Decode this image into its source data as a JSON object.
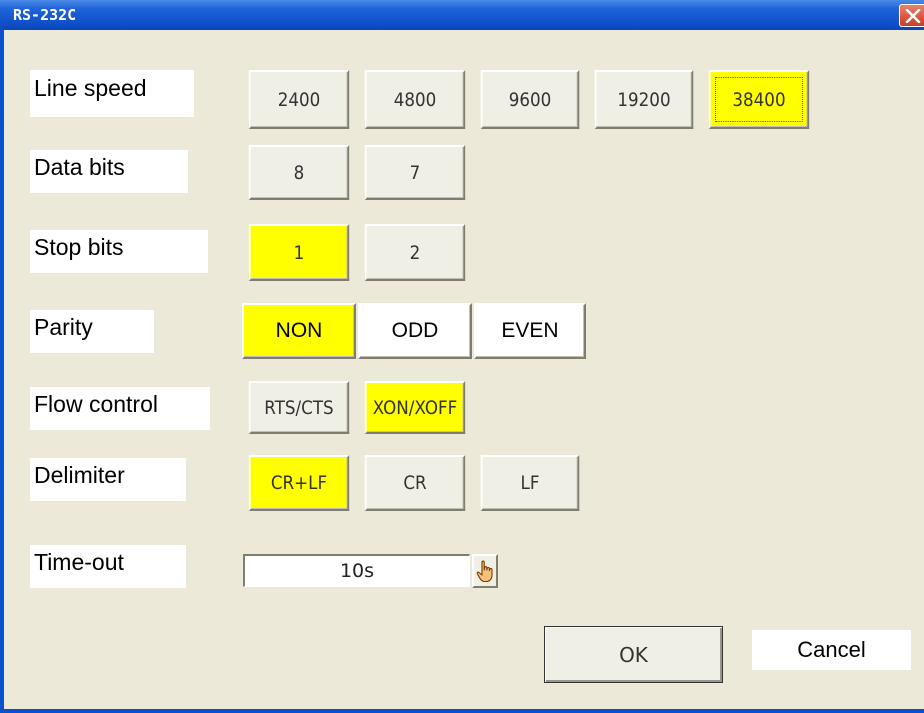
{
  "window": {
    "title": "RS-232C"
  },
  "labels": {
    "line_speed": "Line speed",
    "data_bits": "Data bits",
    "stop_bits": "Stop bits",
    "parity": "Parity",
    "flow_control": "Flow control",
    "delimiter": "Delimiter",
    "time_out": "Time-out"
  },
  "line_speed": {
    "options": [
      "2400",
      "4800",
      "9600",
      "19200",
      "38400"
    ],
    "selected": "38400"
  },
  "data_bits": {
    "options": [
      "8",
      "7"
    ],
    "selected": ""
  },
  "stop_bits": {
    "options": [
      "1",
      "2"
    ],
    "selected": "1"
  },
  "parity": {
    "options": [
      "NON",
      "ODD",
      "EVEN"
    ],
    "selected": "NON"
  },
  "flow_control": {
    "options": [
      "RTS/CTS",
      "XON/XOFF"
    ],
    "selected": "XON/XOFF"
  },
  "delimiter": {
    "options": [
      "CR+LF",
      "CR",
      "LF"
    ],
    "selected": "CR+LF"
  },
  "time_out": {
    "value": "10s",
    "icon": "hand-pointer-icon"
  },
  "buttons": {
    "ok": "OK",
    "cancel": "Cancel"
  },
  "colors": {
    "selected": "#ffff00",
    "title_bar": "#0e4fc9",
    "dialog_bg": "#ece9d8"
  }
}
